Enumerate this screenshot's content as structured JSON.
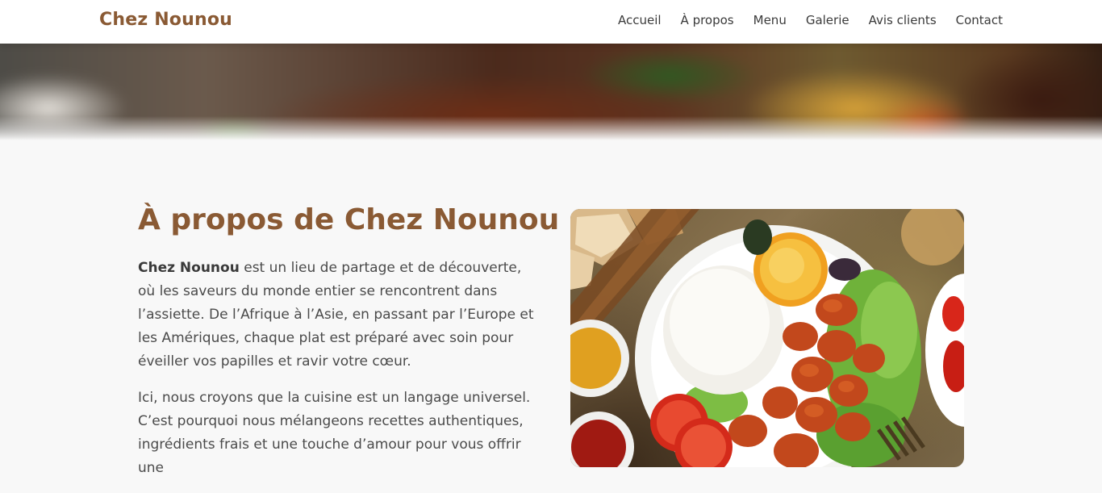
{
  "header": {
    "brand": "Chez Nounou",
    "nav": [
      {
        "label": "Accueil"
      },
      {
        "label": "À propos"
      },
      {
        "label": "Menu"
      },
      {
        "label": "Galerie"
      },
      {
        "label": "Avis clients"
      },
      {
        "label": "Contact"
      }
    ]
  },
  "about": {
    "title": "À propos de Chez Nounou",
    "p1_strong": "Chez Nounou",
    "p1_rest": " est un lieu de partage et de découverte, où les saveurs du monde entier se rencontrent dans l’assiette. De l’Afrique à l’Asie, en passant par l’Europe et les Amériques, chaque plat est préparé avec soin pour éveiller vos papilles et ravir votre cœur.",
    "p2": "Ici, nous croyons que la cuisine est un langage universel. C’est pourquoi nous mélangeons recettes authentiques, ingrédients frais et une touche d’amour pour vous offrir une"
  },
  "colors": {
    "brand": "#8a5a34",
    "nav_text": "#3a3a3a",
    "body_text": "#4a4a4a",
    "page_bg": "#f8f8f8"
  }
}
